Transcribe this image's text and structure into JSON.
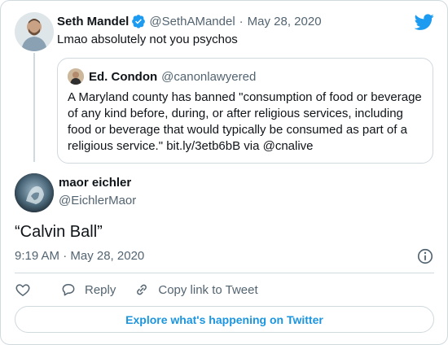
{
  "parent": {
    "name": "Seth Mandel",
    "handle": "@SethAMandel",
    "separator": "·",
    "date": "May 28, 2020",
    "text": "Lmao absolutely not you psychos"
  },
  "quoted": {
    "name": "Ed. Condon",
    "handle": "@canonlawyered",
    "text": "A Maryland county has banned \"consumption of food or beverage of any kind before, during, or after religious services, including food or beverage that would typically be consumed as part of a religious service.\"  bit.ly/3etb6bB via @cnalive"
  },
  "tweet": {
    "name": "maor eichler",
    "handle": "@EichlerMaor",
    "text": "“Calvin Ball”",
    "timestamp": "9:19 AM · May 28, 2020"
  },
  "actions": {
    "reply_label": "Reply",
    "copy_label": "Copy link to Tweet"
  },
  "explore_label": "Explore what's happening on Twitter",
  "colors": {
    "brand_blue": "#1d9bf0",
    "link_blue": "#1b95e0",
    "secondary_text": "#536471",
    "border": "#cfd9de"
  },
  "icons": [
    "verified-badge-icon",
    "twitter-bird-icon",
    "info-icon",
    "heart-icon",
    "reply-icon",
    "link-icon"
  ]
}
